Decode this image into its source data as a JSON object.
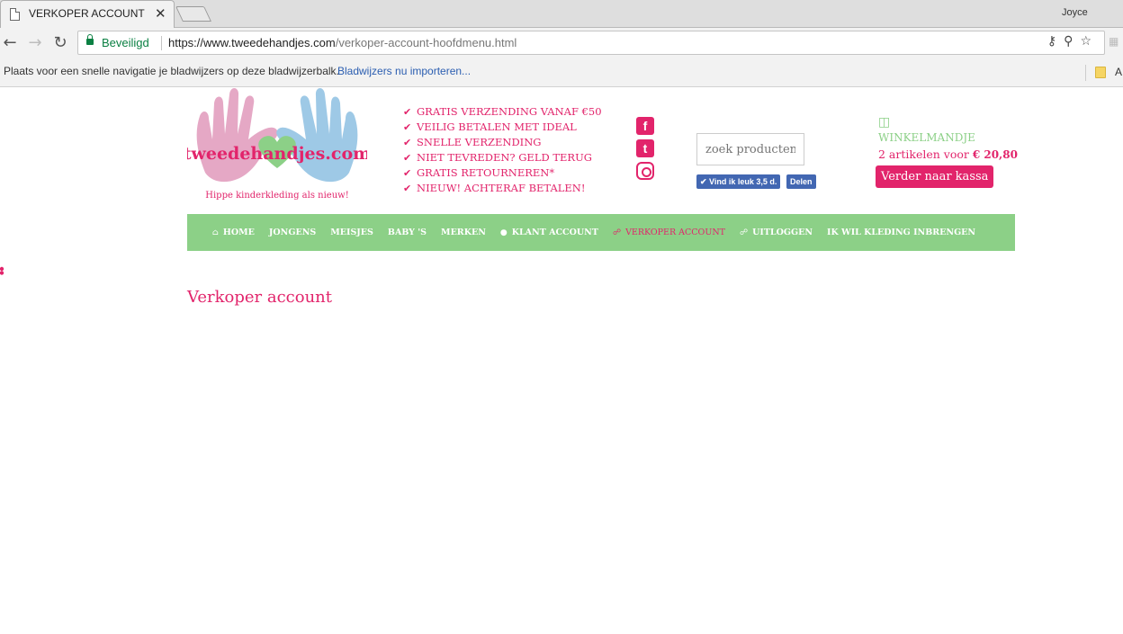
{
  "browser": {
    "tab_title": "VERKOPER ACCOUNT",
    "tab_close": "✕",
    "user": "Joyce",
    "secure_label": "Beveiligd",
    "url_host": "https://www.tweedehandjes.com",
    "url_path": "/verkoper-account-hoofdmenu.html",
    "bookmarks_text": "Plaats voor een snelle navigatie je bladwijzers op deze bladwijzerbalk.",
    "bookmarks_link": "Bladwijzers nu importeren...",
    "bookmarks_more": "A"
  },
  "site": {
    "brand_color": "#e2246b",
    "nav_color": "#8cd087",
    "logo_text": "tweedehandjes.com",
    "logo_tagline": "Hippe kinderkleding als nieuw!",
    "usps": [
      "GRATIS VERZENDING VANAF €50",
      "VEILIG BETALEN MET IDEAL",
      "SNELLE VERZENDING",
      "NIET TEVREDEN? GELD TERUG",
      "GRATIS RETOURNEREN*",
      "NIEUW! ACHTERAF BETALEN!"
    ],
    "social": {
      "facebook": "f",
      "twitter": "t"
    },
    "search_placeholder": "zoek producten",
    "fb_like": "✔ Vind ik leuk 3,5 d.",
    "fb_share": "Delen",
    "basket": {
      "title": "WINKELMANDJE",
      "summary": "2 artikelen voor ",
      "price": "€ 20,80",
      "checkout": "Verder naar kassa"
    },
    "nav": [
      {
        "label": "HOME",
        "icon": "home-icon"
      },
      {
        "label": "JONGENS"
      },
      {
        "label": "MEISJES"
      },
      {
        "label": "BABY 'S"
      },
      {
        "label": "MERKEN"
      },
      {
        "label": "KLANT ACCOUNT",
        "icon": "user-icon"
      },
      {
        "label": "VERKOPER ACCOUNT",
        "icon": "lock-icon",
        "active": true
      },
      {
        "label": "UITLOGGEN",
        "icon": "unlock-icon"
      },
      {
        "label": "IK WIL KLEDING INBRENGEN"
      }
    ],
    "page_heading": "Verkoper account"
  }
}
